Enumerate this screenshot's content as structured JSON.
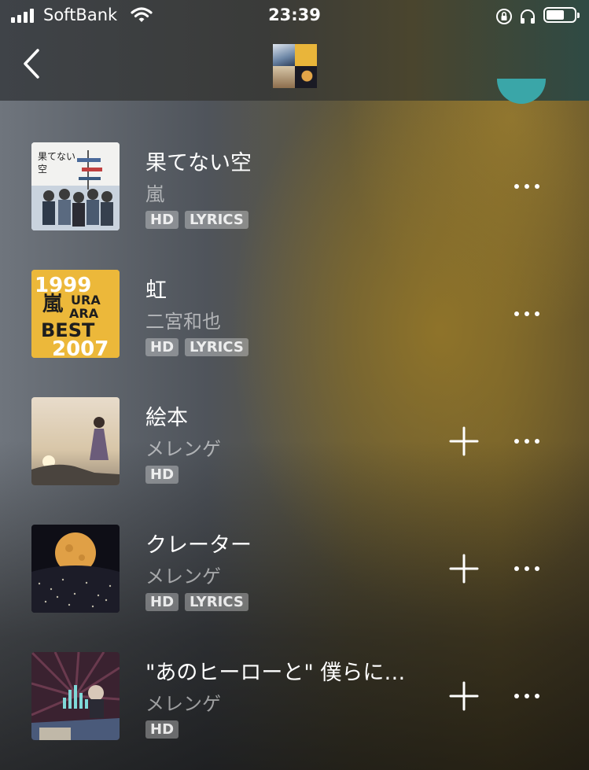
{
  "status_bar": {
    "carrier": "SoftBank",
    "time": "23:39"
  },
  "header": {
    "back_icon": "chevron-left-icon"
  },
  "tracks": [
    {
      "title": "果てない空",
      "artist": "嵐",
      "badges": [
        "HD",
        "LYRICS"
      ],
      "has_add": false
    },
    {
      "title": "虹",
      "artist": "二宮和也",
      "badges": [
        "HD",
        "LYRICS"
      ],
      "has_add": false
    },
    {
      "title": "絵本",
      "artist": "メレンゲ",
      "badges": [
        "HD"
      ],
      "has_add": true
    },
    {
      "title": "クレーター",
      "artist": "メレンゲ",
      "badges": [
        "HD",
        "LYRICS"
      ],
      "has_add": true
    },
    {
      "title": "\"あのヒーローと\" 僕らに…",
      "artist": "メレンゲ",
      "badges": [
        "HD"
      ],
      "has_add": true
    }
  ],
  "album_art_text": {
    "ura_ara_best": [
      "1999",
      "URA",
      "ARA",
      "BEST",
      "2007"
    ]
  },
  "colors": {
    "accent_teal": "#3aa6a8",
    "badge_bg": "rgba(255,255,255,0.32)"
  }
}
